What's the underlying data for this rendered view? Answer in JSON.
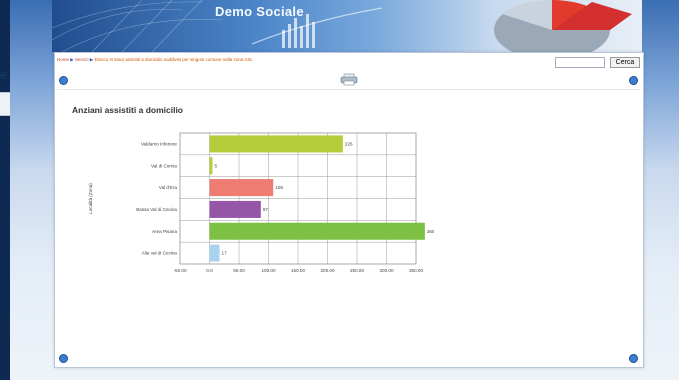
{
  "banner": {
    "title": "Demo Sociale"
  },
  "left": {
    "glyph": "e"
  },
  "breadcrumb": {
    "items": [
      "Home",
      "Servizi",
      "Elenco Anziani assistiti a domicilio suddivisi per singolo comune nella zona ASL"
    ]
  },
  "search": {
    "placeholder": "",
    "button_label": "Cerca"
  },
  "page": {
    "heading": "Anziani assistiti a domicilio"
  },
  "icons": {
    "print": "print-icon",
    "nav_prev": "circle-arrow-icon",
    "nav_next": "circle-arrow-icon"
  },
  "chart_data": {
    "type": "bar",
    "orientation": "horizontal",
    "title": "",
    "ylabel": "Località (Zona)",
    "xlabel": "",
    "categories": [
      "Valdarno Inferiore",
      "Val di Cornia",
      "Val d'Era",
      "Bassa Val di Cecina",
      "Area Pisana",
      "Alta val di Cecina"
    ],
    "values": [
      226,
      5,
      108,
      87,
      365,
      17
    ],
    "value_labels": [
      "226",
      "5",
      "108",
      "87",
      "365",
      "17"
    ],
    "colors": [
      "#b5cc3b",
      "#b5cc3b",
      "#ee7c73",
      "#9556a8",
      "#7cc143",
      "#a9d1f0"
    ],
    "ticks": [
      "-50.00",
      "0.0",
      "50.00",
      "100.00",
      "150.00",
      "200.00",
      "250.00",
      "300.00",
      "350.00"
    ],
    "xlim": [
      -50,
      350
    ],
    "grid": true
  }
}
